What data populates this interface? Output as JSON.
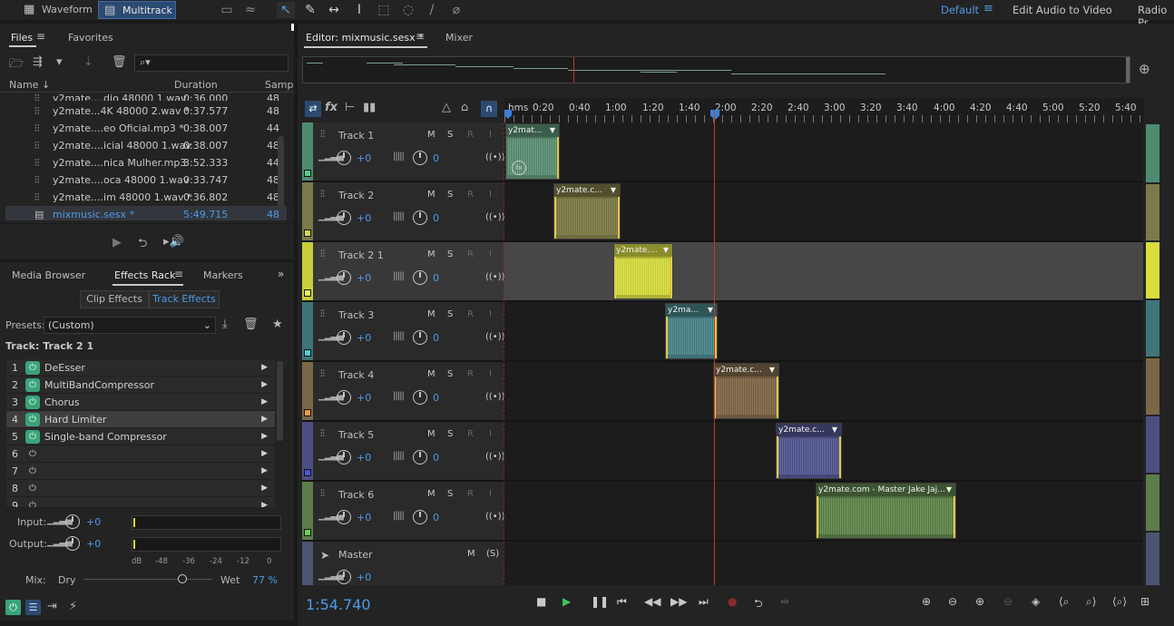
{
  "topbar": {
    "waveform_label": "Waveform",
    "multitrack_label": "Multitrack",
    "workspaces": [
      "Default",
      "Edit Audio to Video",
      "Radio Pr"
    ],
    "menu_icon": "hamburger-icon"
  },
  "files_panel": {
    "tabs": [
      "Files",
      "Favorites"
    ],
    "search_placeholder": "",
    "columns": [
      "Name",
      "Duration",
      "Samp"
    ],
    "rows": [
      {
        "name": "y2mate....dio 48000 1.wav",
        "duration": "0:36.000",
        "samp": "48"
      },
      {
        "name": "y2mate...4K 48000 2.wav *",
        "duration": "0:37.577",
        "samp": "48"
      },
      {
        "name": "y2mate....eo Oficial.mp3 *",
        "duration": "0:38.007",
        "samp": "44"
      },
      {
        "name": "y2mate....icial 48000 1.wav",
        "duration": "0:38.007",
        "samp": "48"
      },
      {
        "name": "y2mate....nica Mulher.mp3",
        "duration": "3:52.333",
        "samp": "44"
      },
      {
        "name": "y2mate....oca 48000 1.wav",
        "duration": "0:33.747",
        "samp": "48"
      },
      {
        "name": "y2mate....im 48000 1.wav *",
        "duration": "0:36.802",
        "samp": "48"
      },
      {
        "name": "mixmusic.sesx *",
        "duration": "5:49.715",
        "samp": "48"
      }
    ]
  },
  "effects_panel": {
    "tabs": [
      "Media Browser",
      "Effects Rack",
      "Markers"
    ],
    "subtabs": [
      "Clip Effects",
      "Track Effects"
    ],
    "presets_label": "Presets:",
    "presets_value": "(Custom)",
    "track_label": "Track: Track 2 1",
    "effects": [
      {
        "num": "1",
        "name": "DeEsser",
        "on": true
      },
      {
        "num": "2",
        "name": "MultiBandCompressor",
        "on": true
      },
      {
        "num": "3",
        "name": "Chorus",
        "on": true
      },
      {
        "num": "4",
        "name": "Hard Limiter",
        "on": true
      },
      {
        "num": "5",
        "name": "Single-band Compressor",
        "on": true
      },
      {
        "num": "6",
        "name": "",
        "on": false
      },
      {
        "num": "7",
        "name": "",
        "on": false
      },
      {
        "num": "8",
        "name": "",
        "on": false
      },
      {
        "num": "9",
        "name": "",
        "on": false
      }
    ],
    "input_label": "Input:",
    "input_value": "+0",
    "output_label": "Output:",
    "output_value": "+0",
    "meter_scale": [
      "dB",
      "-48",
      "-36",
      "-24",
      "-12",
      "0"
    ],
    "mix_label": "Mix:",
    "dry_label": "Dry",
    "wet_label": "Wet",
    "mix_value": "77 %",
    "mix_fraction": 0.77
  },
  "editor": {
    "tab_label": "Editor: mixmusic.sesx *",
    "mixer_label": "Mixer",
    "ruler_labels": [
      "hms",
      "0:20",
      "0:40",
      "1:00",
      "1:20",
      "1:40",
      "2:00",
      "2:20",
      "2:40",
      "3:00",
      "3:20",
      "3:40",
      "4:00",
      "4:20",
      "4:40",
      "5:00",
      "5:20",
      "5:40"
    ],
    "time_display": "1:54.740",
    "tracks": [
      {
        "name": "Track 1",
        "vol": "+0",
        "pan": "0",
        "color": "#4e8c72",
        "sq": "#4ad08a",
        "clip": {
          "label": "y2mat...",
          "color": "#4f7a62",
          "wave": "#6fa588"
        }
      },
      {
        "name": "Track 2",
        "vol": "+0",
        "pan": "0",
        "color": "#7b7a4a",
        "sq": "#d8d64a",
        "clip": {
          "label": "y2mate.c...",
          "color": "#6e6d3f",
          "wave": "#8e8c55"
        }
      },
      {
        "name": "Track 2 1",
        "vol": "+0",
        "pan": "0",
        "color": "#c9ce3a",
        "sq": "#e9f04a",
        "clip": {
          "label": "y2mate....",
          "color": "#aeb236",
          "wave": "#dfe54a"
        }
      },
      {
        "name": "Track 3",
        "vol": "+0",
        "pan": "0",
        "color": "#3f7578",
        "sq": "#4ad0d8",
        "clip": {
          "label": "y2ma...",
          "color": "#3f6f74",
          "wave": "#5b9aa0"
        }
      },
      {
        "name": "Track 4",
        "vol": "+0",
        "pan": "0",
        "color": "#7a6748",
        "sq": "#e79c3c",
        "clip": {
          "label": "y2mate.c...",
          "color": "#6d5a40",
          "wave": "#93795a"
        }
      },
      {
        "name": "Track 5",
        "vol": "+0",
        "pan": "0",
        "color": "#4d4f83",
        "sq": "#4a55d8",
        "clip": {
          "label": "y2mate.c...",
          "color": "#454878",
          "wave": "#6a6daa"
        }
      },
      {
        "name": "Track 6",
        "vol": "+0",
        "pan": "0",
        "color": "#5c7d4a",
        "sq": "#6ad04a",
        "clip": {
          "label": "y2mate.com - Master Jake  Jaj...",
          "color": "#4f6d3f",
          "wave": "#77a05e"
        }
      }
    ],
    "master": {
      "name": "Master",
      "vol": "+0"
    },
    "track_buttons": [
      "M",
      "S",
      "R",
      "I"
    ]
  }
}
